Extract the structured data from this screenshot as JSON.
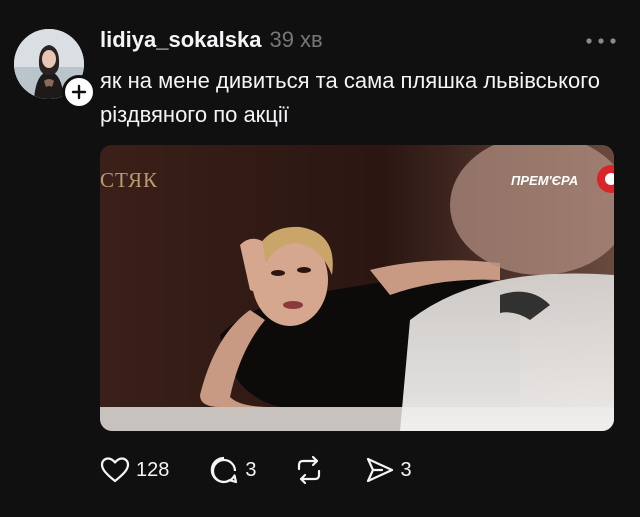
{
  "post": {
    "username": "lidiya_sokalska",
    "timestamp": "39 хв",
    "caption": "як на мене дивиться та сама пляшка львівського різдвяного по акції",
    "media": {
      "show_name": "СТЯК",
      "badge": "ПРЕМ'ЄРА"
    },
    "actions": {
      "likes": "128",
      "replies": "3",
      "shares": "3"
    },
    "icons": {
      "avatar": "profile-photo",
      "follow": "plus-icon",
      "more": "ellipsis-icon",
      "like": "heart-icon",
      "reply": "comment-icon",
      "repost": "repost-icon",
      "share": "send-icon"
    }
  }
}
